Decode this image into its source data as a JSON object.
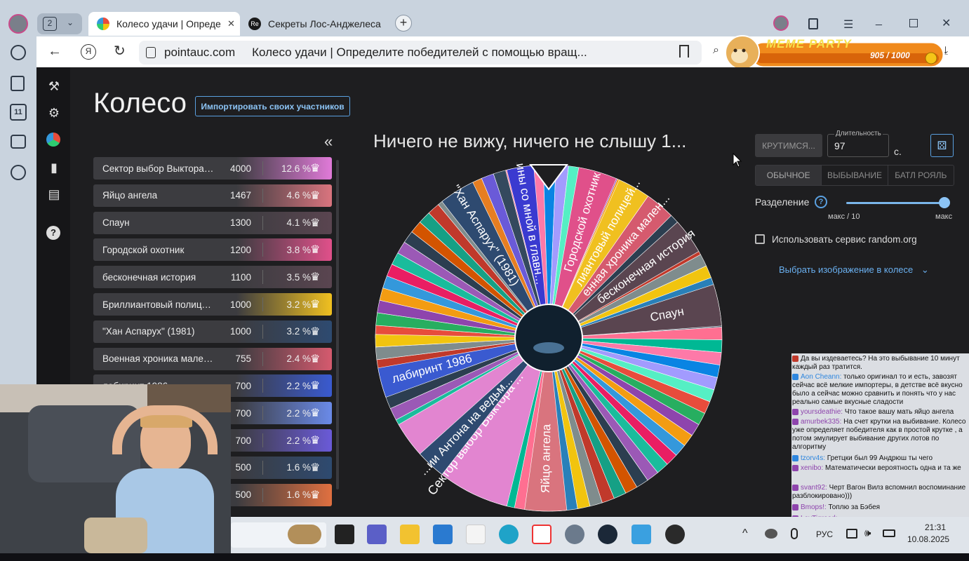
{
  "browser": {
    "tab_count": "2",
    "tabs": [
      {
        "title": "Колесо удачи | Опреде"
      },
      {
        "title": "Секреты Лос-Анджелеса"
      }
    ],
    "url": "pointauc.com",
    "page_title": "Колесо удачи | Определите победителей с помощью вращ..."
  },
  "meme_party": {
    "title": "MEME PARTY",
    "progress_text": "905 / 1000",
    "progress": 0.905
  },
  "app": {
    "heading": "Колесо",
    "import_button": "Импортировать своих участников",
    "collapse_icon": "«",
    "winner_text": "Ничего не вижу, ничего не слышу 1..."
  },
  "participants": [
    {
      "name": "Сектор выбор Выктора п...",
      "amount": "4000",
      "percent": "12.6 %",
      "color": "#e07ad8"
    },
    {
      "name": "Яйцо ангела",
      "amount": "1467",
      "percent": "4.6 %",
      "color": "#d9747e"
    },
    {
      "name": "Спаун",
      "amount": "1300",
      "percent": "4.1 %",
      "color": "#5a4550"
    },
    {
      "name": "Городской охотник",
      "amount": "1200",
      "percent": "3.8 %",
      "color": "#e0508a"
    },
    {
      "name": "бесконечная история",
      "amount": "1100",
      "percent": "3.5 %",
      "color": "#5a4550"
    },
    {
      "name": "Бриллиантовый полицейс...",
      "amount": "1000",
      "percent": "3.2 %",
      "color": "#f0c020"
    },
    {
      "name": "\"Хан Аспарух\" (1981)",
      "amount": "1000",
      "percent": "3.2 %",
      "color": "#2e4a70"
    },
    {
      "name": "Военная хроника маленьк...",
      "amount": "755",
      "percent": "2.4 %",
      "color": "#d55a6e"
    },
    {
      "name": "лабиринт 1986",
      "amount": "700",
      "percent": "2.2 %",
      "color": "#3a5ad0"
    },
    {
      "name": "",
      "amount": "700",
      "percent": "2.2 %",
      "color": "#6a8ae8"
    },
    {
      "name": "",
      "amount": "700",
      "percent": "2.2 %",
      "color": "#6a5ad8"
    },
    {
      "name": "",
      "amount": "500",
      "percent": "1.6 %",
      "color": "#2e4a70"
    },
    {
      "name": "",
      "amount": "500",
      "percent": "1.6 %",
      "color": "#e07040"
    }
  ],
  "wheel_labels": [
    "Сектор выбор Выктора ...",
    "Яйцо ангела",
    "Спаун",
    "Городской охотник",
    "бесконечная история",
    "лиантовый полицей...",
    "енная хроника мален...",
    "\"Хан Аспарух\" (1981)",
    "лабиринт 1986",
    "...ии Антона на ведьм...",
    "...ины со мной в главн..."
  ],
  "controls": {
    "spin_button": "КРУТИМСЯ...",
    "duration_label": "Длительность",
    "duration_value": "97",
    "duration_unit": "с.",
    "dice_icon": "dice-icon",
    "modes": [
      "ОБЫЧНОЕ",
      "ВЫБЫВАНИЕ",
      "БАТЛ РОЯЛЬ"
    ],
    "active_mode": "ОБЫЧНОЕ",
    "split_label": "Разделение",
    "split_min": "макс / 10",
    "split_max": "макс",
    "split_value": 1.0,
    "random_org_label": "Использовать сервис random.org",
    "image_select": "Выбрать изображение в колесе"
  },
  "chat": [
    {
      "user": "",
      "text": "Да вы издеваетесь? На это выбывание 10 минут каждый раз тратится.",
      "color": "#c0392b"
    },
    {
      "user": "Aon Cheann",
      "text": "только оригинал то и есть, завозят сейчас всё мелкие импортеры, в детстве всё вкусно было а сейчас можно сравнить и понять что у нас реально самые вкусные сладости",
      "color": "#2e86de"
    },
    {
      "user": "yoursdeathie",
      "text": "Что такое вашу мать яйцо ангела",
      "color": "#8e44ad"
    },
    {
      "user": "amurbek335",
      "text": "На счет крутки на выбивание. Колесо уже определяет победителя как в простой крутке , а потом эмулирует выбивание других лотов по алгоритму",
      "color": "#8e44ad"
    },
    {
      "user": "tzorv4s",
      "text": "Гретцки был 99 Андрюш ты чего",
      "color": "#2e86de"
    },
    {
      "user": "xenibo",
      "text": "Математически вероятность одна и та же",
      "color": "#8e44ad"
    },
    {
      "user": "svant92",
      "text": "Черт Вагон Вилз вспомнил воспоминание разблокировано)))",
      "color": "#8e44ad"
    },
    {
      "user": "Bmops!",
      "text": "Топлю за Бэбея",
      "color": "#8e44ad"
    },
    {
      "user": "LevTigroed",
      "text": "",
      "color": "#8e44ad"
    }
  ],
  "taskbar": {
    "lang": "РУС",
    "time": "21:31",
    "date": "10.08.2025"
  }
}
